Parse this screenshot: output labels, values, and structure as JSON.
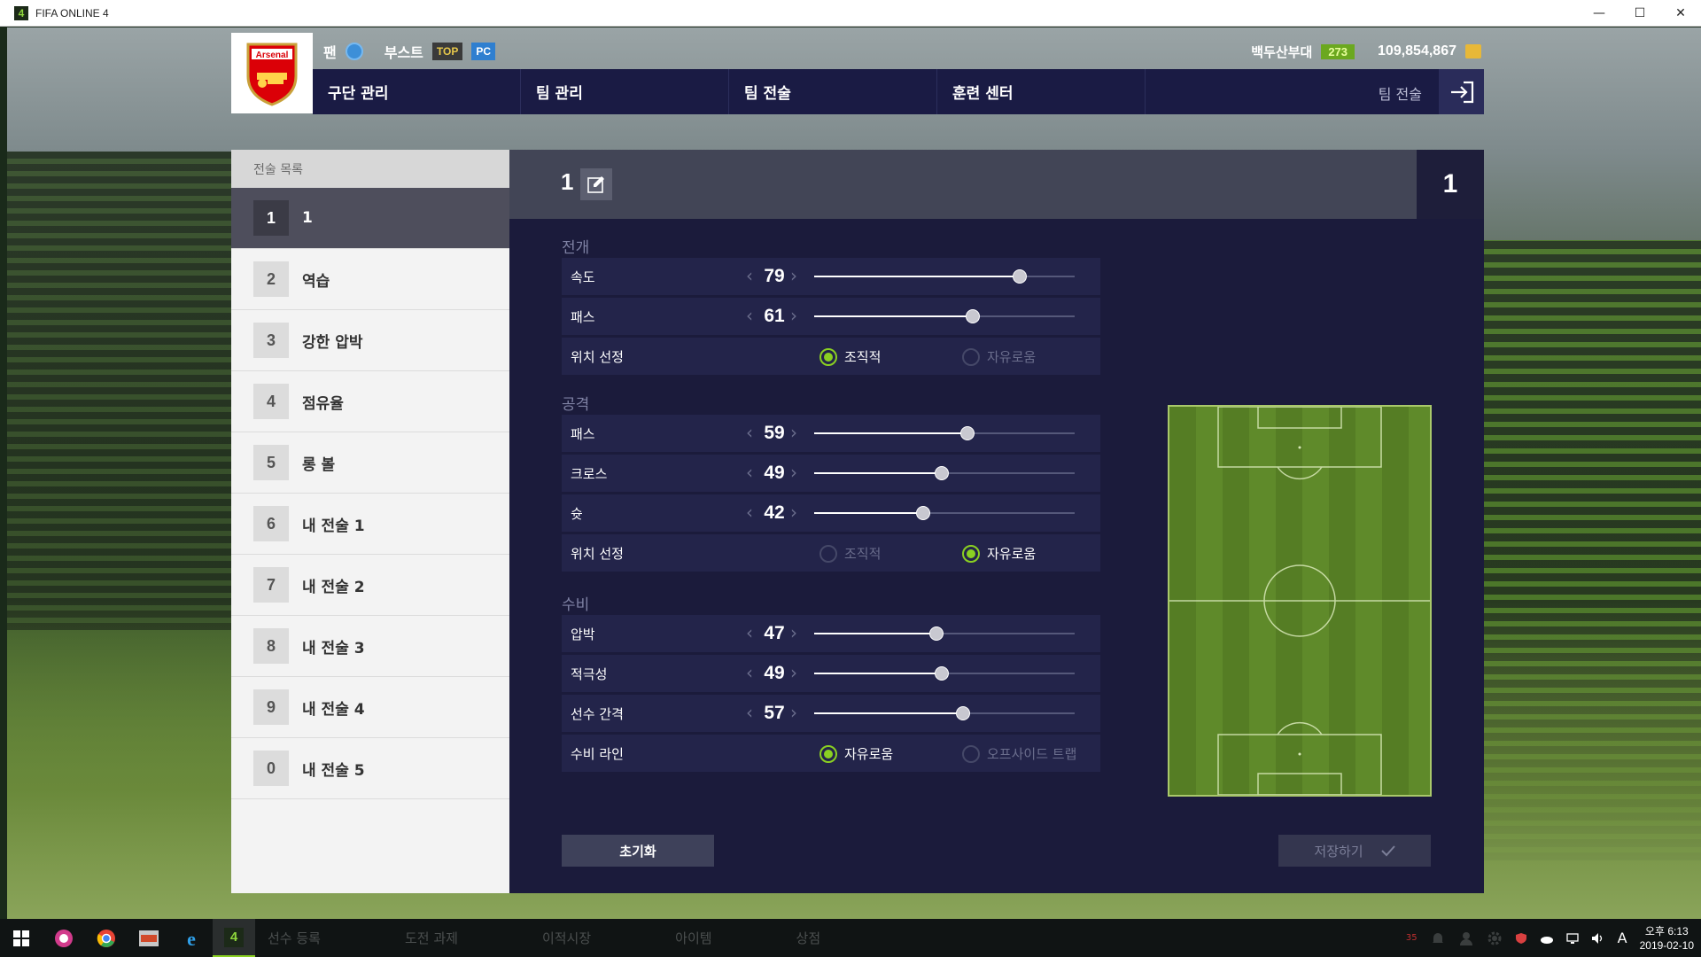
{
  "window": {
    "title": "FIFA ONLINE 4",
    "app_icon": "4",
    "controls": {
      "minimize": "—",
      "maximize": "☐",
      "close": "✕"
    }
  },
  "header": {
    "club_crest_text": "Arsenal",
    "fan_label": "팬",
    "boost_label": "부스트",
    "tags": [
      "TOP",
      "PC"
    ],
    "rank_label": "백두산부대",
    "rank_level": "273",
    "coins": "109,854,867"
  },
  "nav": {
    "tabs": [
      "구단 관리",
      "팀 관리",
      "팀 전술",
      "훈련 센터"
    ],
    "right_label": "팀 전술"
  },
  "tactic_list": {
    "header": "전술 목록",
    "items": [
      {
        "num": "1",
        "label": "1"
      },
      {
        "num": "2",
        "label": "역습"
      },
      {
        "num": "3",
        "label": "강한 압박"
      },
      {
        "num": "4",
        "label": "점유율"
      },
      {
        "num": "5",
        "label": "롱 볼"
      },
      {
        "num": "6",
        "label": "내 전술 1"
      },
      {
        "num": "7",
        "label": "내 전술 2"
      },
      {
        "num": "8",
        "label": "내 전술 3"
      },
      {
        "num": "9",
        "label": "내 전술 4"
      },
      {
        "num": "0",
        "label": "내 전술 5"
      }
    ]
  },
  "panel": {
    "title": "1",
    "badge": "1",
    "sections": {
      "buildup": {
        "title": "전개",
        "speed": {
          "label": "속도",
          "value": "79"
        },
        "pass": {
          "label": "패스",
          "value": "61"
        },
        "positioning": {
          "label": "위치 선정",
          "option_a": "조직적",
          "option_b": "자유로움",
          "selected": "조직적"
        }
      },
      "attack": {
        "title": "공격",
        "pass": {
          "label": "패스",
          "value": "59"
        },
        "cross": {
          "label": "크로스",
          "value": "49"
        },
        "shoot": {
          "label": "슛",
          "value": "42"
        },
        "positioning": {
          "label": "위치 선정",
          "option_a": "조직적",
          "option_b": "자유로움",
          "selected": "자유로움"
        }
      },
      "defense": {
        "title": "수비",
        "pressure": {
          "label": "압박",
          "value": "47"
        },
        "aggression": {
          "label": "적극성",
          "value": "49"
        },
        "width": {
          "label": "선수 간격",
          "value": "57"
        },
        "line": {
          "label": "수비 라인",
          "option_a": "자유로움",
          "option_b": "오프사이드 트랩",
          "selected": "자유로움"
        }
      }
    },
    "reset_label": "초기화",
    "save_label": "저장하기"
  },
  "taskbar": {
    "game_menu": [
      "선수 등록",
      "도전 과제",
      "이적시장",
      "아이템",
      "상점"
    ],
    "notification_count": "35",
    "ime": "A",
    "time": "오후 6:13",
    "date": "2019-02-10"
  },
  "colors": {
    "nav_bg": "#1a1b44",
    "panel_bg": "#1b1b3b",
    "accent_green": "#8ad022",
    "list_selected": "#4e4e5c"
  }
}
